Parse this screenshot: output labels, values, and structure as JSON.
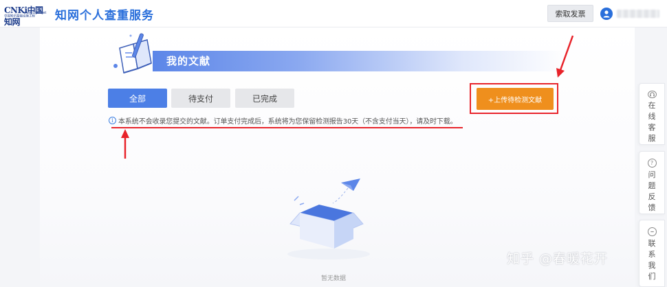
{
  "header": {
    "logo": {
      "main_text": "CNKi中国知网",
      "url_text": "www.cnki.net",
      "sub_text": "中国知识基础设施工程"
    },
    "app_title": "知网个人查重服务",
    "invoice_button_label": "索取发票"
  },
  "banner": {
    "title": "我的文献"
  },
  "tabs": [
    {
      "label": "全部",
      "active": true
    },
    {
      "label": "待支付",
      "active": false
    },
    {
      "label": "已完成",
      "active": false
    }
  ],
  "upload_button_label": "+上传待检测文献",
  "notice": {
    "text": "本系统不会收录您提交的文献。订单支付完成后，系统将为您保留检测报告30天（不含支付当天），请及时下载。"
  },
  "empty_state": {
    "text": "暂无数据"
  },
  "sidebar": [
    {
      "icon": "headset-icon",
      "label": "在线客服"
    },
    {
      "icon": "question-icon",
      "label": "问题反馈"
    },
    {
      "icon": "chat-icon",
      "label": "联系我们"
    }
  ],
  "watermark": "知乎 @春暖花开",
  "colors": {
    "accent_blue": "#4c7fe6",
    "upload_orange": "#ef8f1d",
    "annotation_red": "#e8232a",
    "title_blue": "#2a6fdb"
  }
}
